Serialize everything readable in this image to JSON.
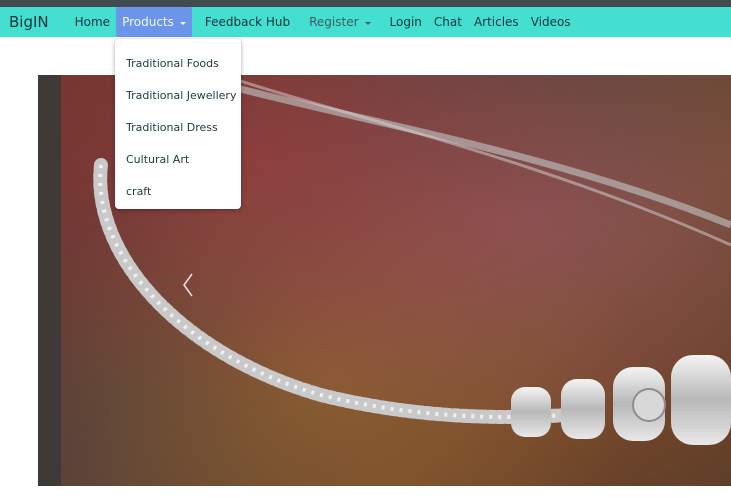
{
  "navbar": {
    "brand": "BigIN",
    "items": [
      {
        "label": "Home"
      },
      {
        "label": "Products"
      },
      {
        "label": "Feedback Hub"
      },
      {
        "label": "Register"
      },
      {
        "label": "Login"
      },
      {
        "label": "Chat"
      },
      {
        "label": "Articles"
      },
      {
        "label": "Videos"
      }
    ],
    "colors": {
      "bar": "#43e0d2",
      "active": "#6b95e8",
      "topstrip": "#404a4f"
    }
  },
  "products_menu": {
    "items": [
      {
        "label": "Traditional Foods"
      },
      {
        "label": "Traditional Jewellery"
      },
      {
        "label": "Traditional Dress"
      },
      {
        "label": "Cultural Art"
      },
      {
        "label": "craft"
      }
    ]
  },
  "carousel": {
    "prev_icon": "chevron-left-icon"
  }
}
